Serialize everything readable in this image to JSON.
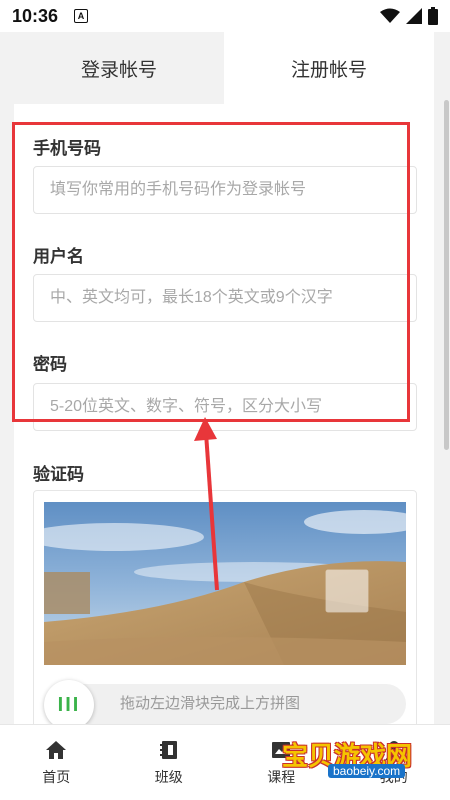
{
  "status_bar": {
    "time": "10:36",
    "notification_badge": "A"
  },
  "tabs": [
    {
      "label": "登录帐号",
      "active": false
    },
    {
      "label": "注册帐号",
      "active": true
    }
  ],
  "form": {
    "phone": {
      "label": "手机号码",
      "placeholder": "填写你常用的手机号码作为登录帐号"
    },
    "username": {
      "label": "用户名",
      "placeholder": "中、英文均可，最长18个英文或9个汉字"
    },
    "password": {
      "label": "密码",
      "placeholder": "5-20位英文、数字、符号，区分大小写"
    }
  },
  "captcha": {
    "label": "验证码",
    "slider_text": "拖动左边滑块完成上方拼图",
    "handle_glyph": "III"
  },
  "bottom_nav": [
    {
      "label": "首页",
      "icon": "home-icon"
    },
    {
      "label": "班级",
      "icon": "class-icon"
    },
    {
      "label": "课程",
      "icon": "course-icon"
    },
    {
      "label": "我的",
      "icon": "profile-icon"
    }
  ],
  "watermark": {
    "title": "宝贝游戏网",
    "url": "baobeiy.com"
  },
  "colors": {
    "annotation_red": "#e8363a",
    "slider_green": "#3bb34a",
    "page_gray": "#f2f2f2"
  }
}
